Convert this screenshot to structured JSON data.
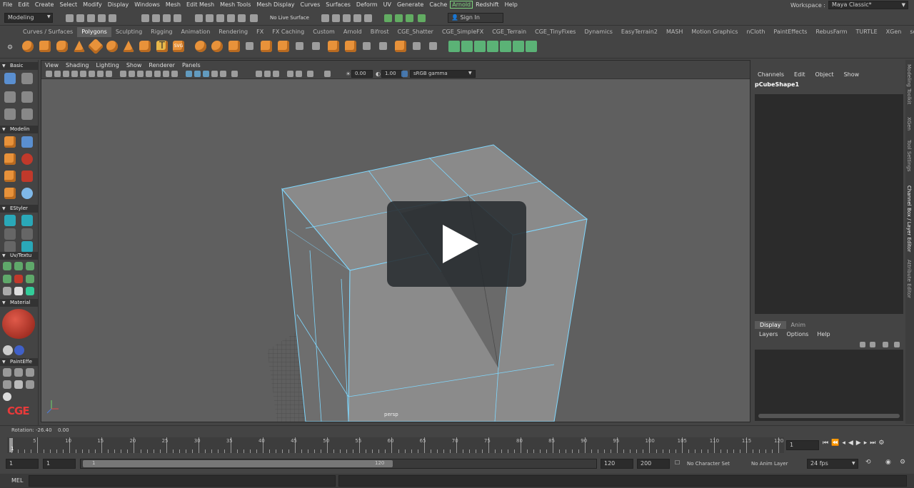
{
  "menubar": {
    "items": [
      "File",
      "Edit",
      "Create",
      "Select",
      "Modify",
      "Display",
      "Windows",
      "Mesh",
      "Edit Mesh",
      "Mesh Tools",
      "Mesh Display",
      "Curves",
      "Surfaces",
      "Deform",
      "UV",
      "Generate",
      "Cache",
      "Arnold",
      "Redshift",
      "Help"
    ],
    "workspace_label": "Workspace :",
    "workspace_value": "Maya Classic*"
  },
  "statusline": {
    "mode": "Modeling",
    "live_surface": "No Live Surface",
    "sign_in": "Sign In"
  },
  "shelf": {
    "tabs": [
      "Curves / Surfaces",
      "Polygons",
      "Sculpting",
      "Rigging",
      "Animation",
      "Rendering",
      "FX",
      "FX Caching",
      "Custom",
      "Arnold",
      "Bifrost",
      "CGE_Shatter",
      "CGE_SimpleFX",
      "CGE_Terrain",
      "CGE_TinyFixes",
      "Dynamics",
      "EasyTerrain2",
      "MASH",
      "Motion Graphics",
      "nCloth",
      "PaintEffects",
      "RebusFarm",
      "TURTLE",
      "XGen",
      "soup"
    ],
    "active": "Polygons"
  },
  "toolbox": {
    "sections": [
      "Basic",
      "Modelin",
      "EStyler",
      "Uv/Textu",
      "Material",
      "PaintEffe"
    ],
    "logo": "CGE"
  },
  "viewport": {
    "menu": [
      "View",
      "Shading",
      "Lighting",
      "Show",
      "Renderer",
      "Panels"
    ],
    "exposure": "0.00",
    "gamma": "1.00",
    "colorspace": "sRGB gamma",
    "camera": "persp"
  },
  "channel_box": {
    "menu": [
      "Channels",
      "Edit",
      "Object",
      "Show"
    ],
    "object": "pCubeShape1"
  },
  "layer_editor": {
    "tabs": [
      "Display",
      "Anim"
    ],
    "active_tab": "Display",
    "menu": [
      "Layers",
      "Options",
      "Help"
    ]
  },
  "side_tabs": [
    "Modeling Toolkit",
    "XGen",
    "Tool Settings",
    "Channel Box / Layer Editor",
    "Attribute Editor"
  ],
  "help_line": {
    "label": "Rotation:",
    "value1": "-26.40",
    "value2": "0.00"
  },
  "time_slider": {
    "ticks": [
      "5",
      "10",
      "15",
      "20",
      "25",
      "30",
      "35",
      "40",
      "45",
      "50",
      "55",
      "60",
      "65",
      "70",
      "75",
      "80",
      "85",
      "90",
      "95",
      "100",
      "105",
      "110",
      "115",
      "120"
    ],
    "current_marker": "1",
    "current_frame": "1"
  },
  "range": {
    "start": "1",
    "playback_start": "1",
    "slider_start": "1",
    "slider_end": "120",
    "playback_end": "120",
    "end": "200",
    "character_set": "No Character Set",
    "anim_layer": "No Anim Layer",
    "fps": "24 fps"
  },
  "command_line": {
    "label": "MEL"
  },
  "colors": {
    "accent_green": "#7fd67f",
    "wire_cyan": "#7fd8ff",
    "shelf_orange": "#e8923a"
  }
}
